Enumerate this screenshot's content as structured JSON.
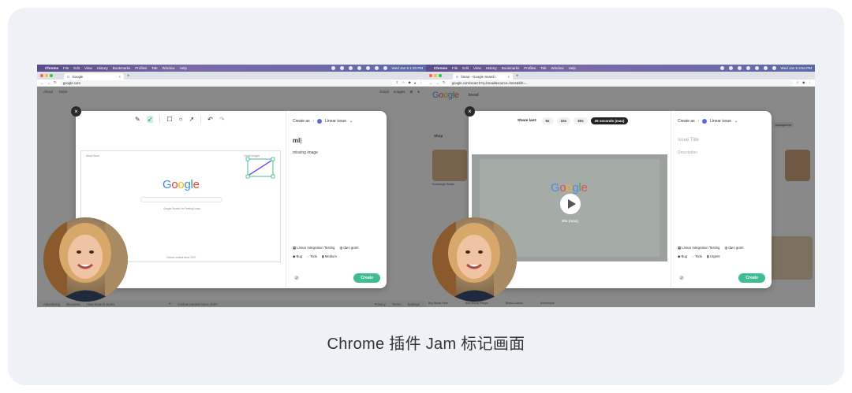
{
  "caption": "Chrome 插件 Jam 标记画面",
  "left": {
    "menubar": {
      "items": [
        "Chrome",
        "File",
        "Edit",
        "View",
        "History",
        "Bookmarks",
        "Profiles",
        "Tab",
        "Window",
        "Help"
      ],
      "clock": "Wed Jan 5 1:20 PM"
    },
    "tab_title": "Google",
    "url": "google.com",
    "page_nav": {
      "about": "About",
      "store": "Store",
      "gmail": "Gmail",
      "images": "Images"
    },
    "footer": {
      "advertising": "Advertising",
      "business": "Business",
      "how_search": "How Search works",
      "carbon": "Carbon neutral since 2007",
      "privacy": "Privacy",
      "terms": "Terms",
      "settings": "Settings"
    },
    "shot_text": {
      "search_btn": "Google Search",
      "lucky_btn": "I'm Feeling Lucky"
    },
    "side": {
      "create_as": "Create as",
      "integration": "Linear issue",
      "title_value": "ml",
      "description_value": "missing image",
      "team": "Linear Integration Testing",
      "assignee": "dani grant",
      "label": "Bug",
      "status": "Todo",
      "priority": "Medium",
      "create": "Create"
    }
  },
  "right": {
    "menubar": {
      "items": [
        "Chrome",
        "File",
        "Edit",
        "View",
        "History",
        "Bookmarks",
        "Profiles",
        "Tab",
        "Window",
        "Help"
      ],
      "clock": "Wed Jan 5 3:54 PM"
    },
    "tab_title": "bread - Google Search",
    "url": "google.com/search?q=bread&source=lmns&bih=...",
    "search_query": "bread",
    "share_last": "Share last:",
    "durations": [
      "5s",
      "10s",
      "30s",
      "25 seconds (max)"
    ],
    "video_overlay": "30s (max)",
    "page_labels": {
      "shop": "Shop",
      "a1": "Sourdough Bread",
      "a2": "Best Bread Recipe",
      "a3": "Bread Loaves",
      "a4": "Homemade",
      "buy": "Buy Bread Here",
      "transparent": "transparent"
    },
    "side": {
      "create_as": "Create as",
      "integration": "Linear issue",
      "title_placeholder": "Issue Title",
      "description_placeholder": "Description",
      "team": "Linear Integration Testing",
      "assignee": "dani grant",
      "label": "Bug",
      "status": "Todo",
      "priority": "Urgent",
      "create": "Create"
    }
  },
  "colors": {
    "accent_green": "#3fbd8f",
    "linear_purple": "#5e6ad2",
    "menubar": "#6a5d9c"
  },
  "icons": [
    "apple-icon",
    "pen-icon",
    "cursor-icon",
    "rectangle-icon",
    "circle-icon",
    "arrow-icon",
    "undo-icon",
    "redo-icon",
    "close-icon",
    "chevron-down-icon",
    "paperclip-icon",
    "play-icon"
  ]
}
